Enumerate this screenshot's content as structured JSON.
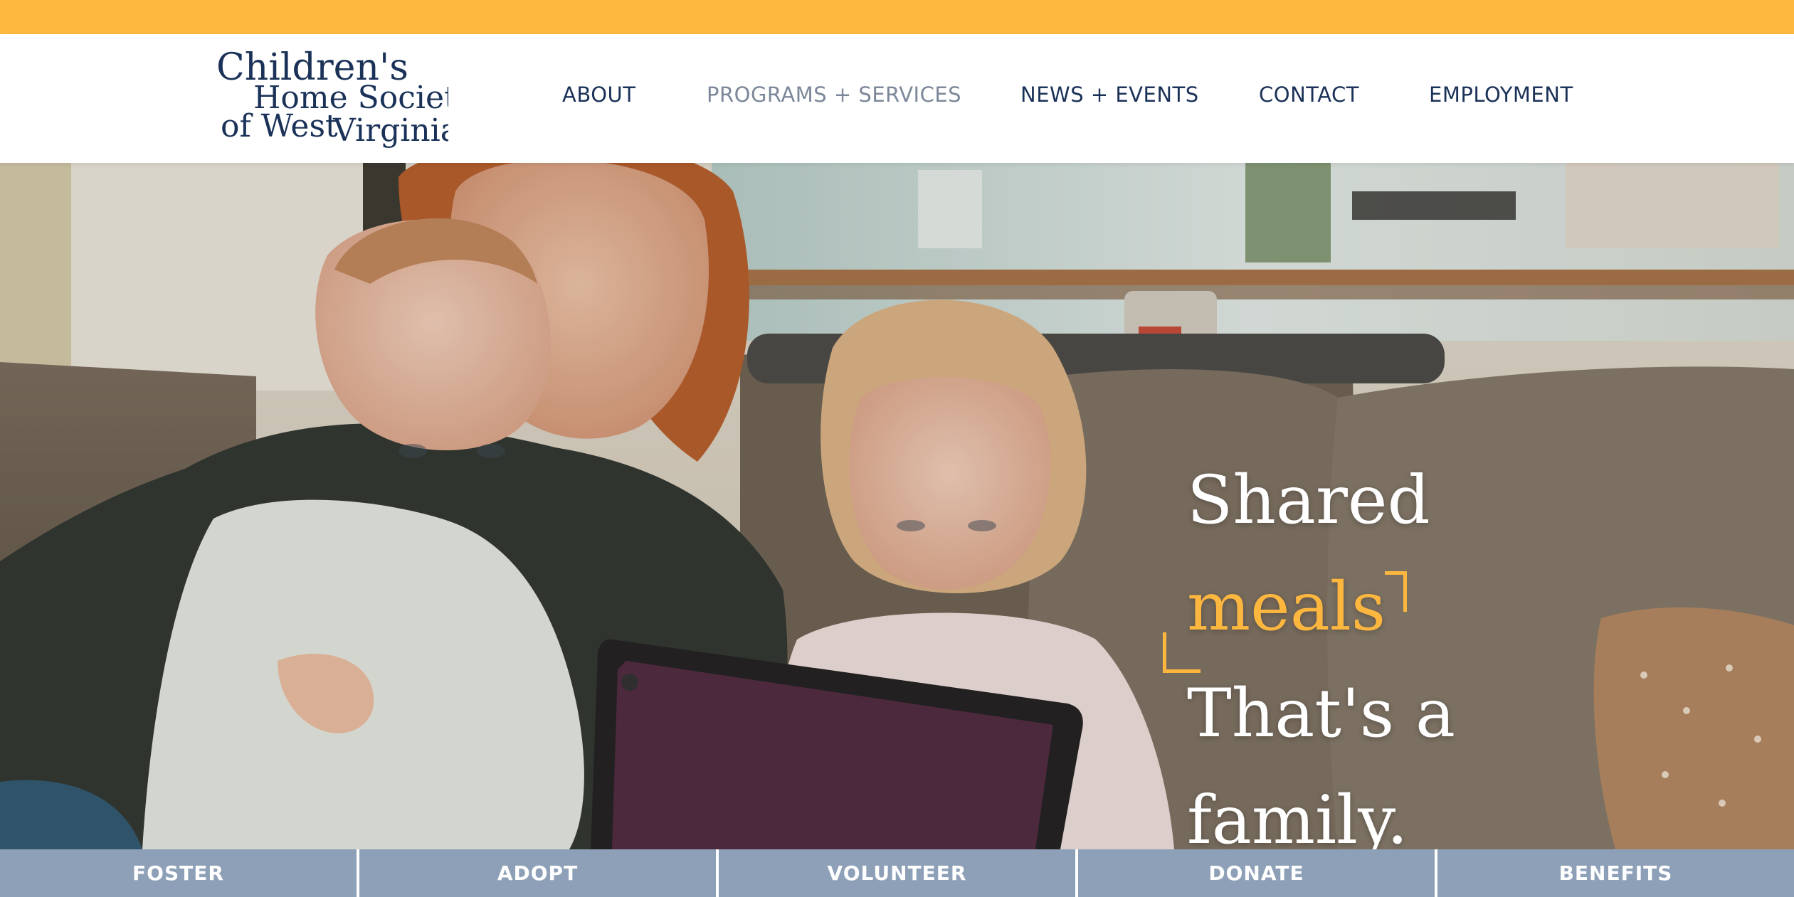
{
  "colors": {
    "brand_yellow": "#FDB73F",
    "navy": "#1B3258",
    "slate_bar": "#8EA0B8"
  },
  "logo": {
    "line1": "Children's",
    "line2": "Home Society",
    "line3a": "of West",
    "line3b": "Virginia"
  },
  "nav": {
    "items": [
      {
        "label": "ABOUT"
      },
      {
        "label": "PROGRAMS + SERVICES"
      },
      {
        "label": "NEWS + EVENTS"
      },
      {
        "label": "CONTACT"
      },
      {
        "label": "EMPLOYMENT"
      }
    ]
  },
  "hero": {
    "line1": "Shared",
    "accent": "meals",
    "line3": "That's a",
    "line4": "family."
  },
  "bottom_nav": {
    "items": [
      {
        "label": "FOSTER"
      },
      {
        "label": "ADOPT"
      },
      {
        "label": "VOLUNTEER"
      },
      {
        "label": "DONATE"
      },
      {
        "label": "BENEFITS"
      }
    ]
  }
}
